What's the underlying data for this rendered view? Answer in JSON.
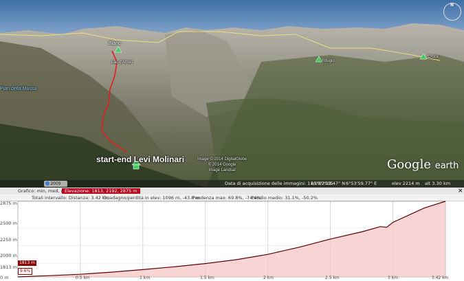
{
  "view": {
    "place_labels": {
      "bivacco": "Blanc",
      "lac": "Lac d'Arnas",
      "valley": "Pian della Mussa",
      "right_peak": "Rifugio",
      "far_right": "Croce"
    },
    "start_label": "start-end Levi Molinari",
    "credits": [
      "Image © 2014 DigitalGlobe",
      "© 2014 Google",
      "Image Landsat"
    ],
    "logo": {
      "google": "Google",
      "earth": "earth"
    },
    "year_badge": "2009",
    "status": {
      "acq_date": "Data di acquisizione delle immagini: 11/19/2005",
      "lat": "45°07'13.47\" N",
      "lon": "6°53'59.77\" E",
      "elev": "elev  2214 m",
      "alt": "alt  3.30 km"
    },
    "compass_n": "N"
  },
  "profile": {
    "title_left": "Grafico: min, med, max:",
    "title_highlight": "Elevazione: 1813, 2192, 2875 m",
    "stats": {
      "total": "Totali intervallo: Distanza: 3.42 km",
      "gain": "Guadagno/perdita in elev: 1096 m, -43.8 m",
      "slope_max": "Pendenza max: 69.8%, -74.4%",
      "slope_avg": "Pendio medio: 31.1%, -50.2%"
    },
    "close": "×",
    "y_ticks": [
      "2875 m",
      "2500 m",
      "2250 m",
      "2000 m",
      "1813 m",
      "0 m"
    ],
    "x_ticks": [
      "0.5 km",
      "1 km",
      "1.5 km",
      "2 km",
      "2.5 km",
      "3 km",
      "3.42 km"
    ],
    "cursor_elev": "1813 m",
    "cursor_slope": "9.6%"
  },
  "chart_data": {
    "type": "area",
    "title": "",
    "xlabel": "",
    "ylabel": "",
    "xlim": [
      0,
      3.42
    ],
    "ylim": [
      1813,
      2875
    ],
    "x": [
      0,
      0.25,
      0.5,
      0.75,
      1.0,
      1.25,
      1.5,
      1.75,
      2.0,
      2.25,
      2.5,
      2.75,
      2.9,
      2.95,
      3.0,
      3.25,
      3.42
    ],
    "series": [
      {
        "values": [
          1813,
          1830,
          1850,
          1880,
          1915,
          1955,
          2000,
          2055,
          2130,
          2230,
          2345,
          2445,
          2520,
          2510,
          2580,
          2780,
          2875
        ]
      }
    ],
    "grid": true,
    "colors": {
      "line": "#5a0000",
      "fill": "#f7c9c9",
      "grid": "#bbbbbb"
    }
  }
}
